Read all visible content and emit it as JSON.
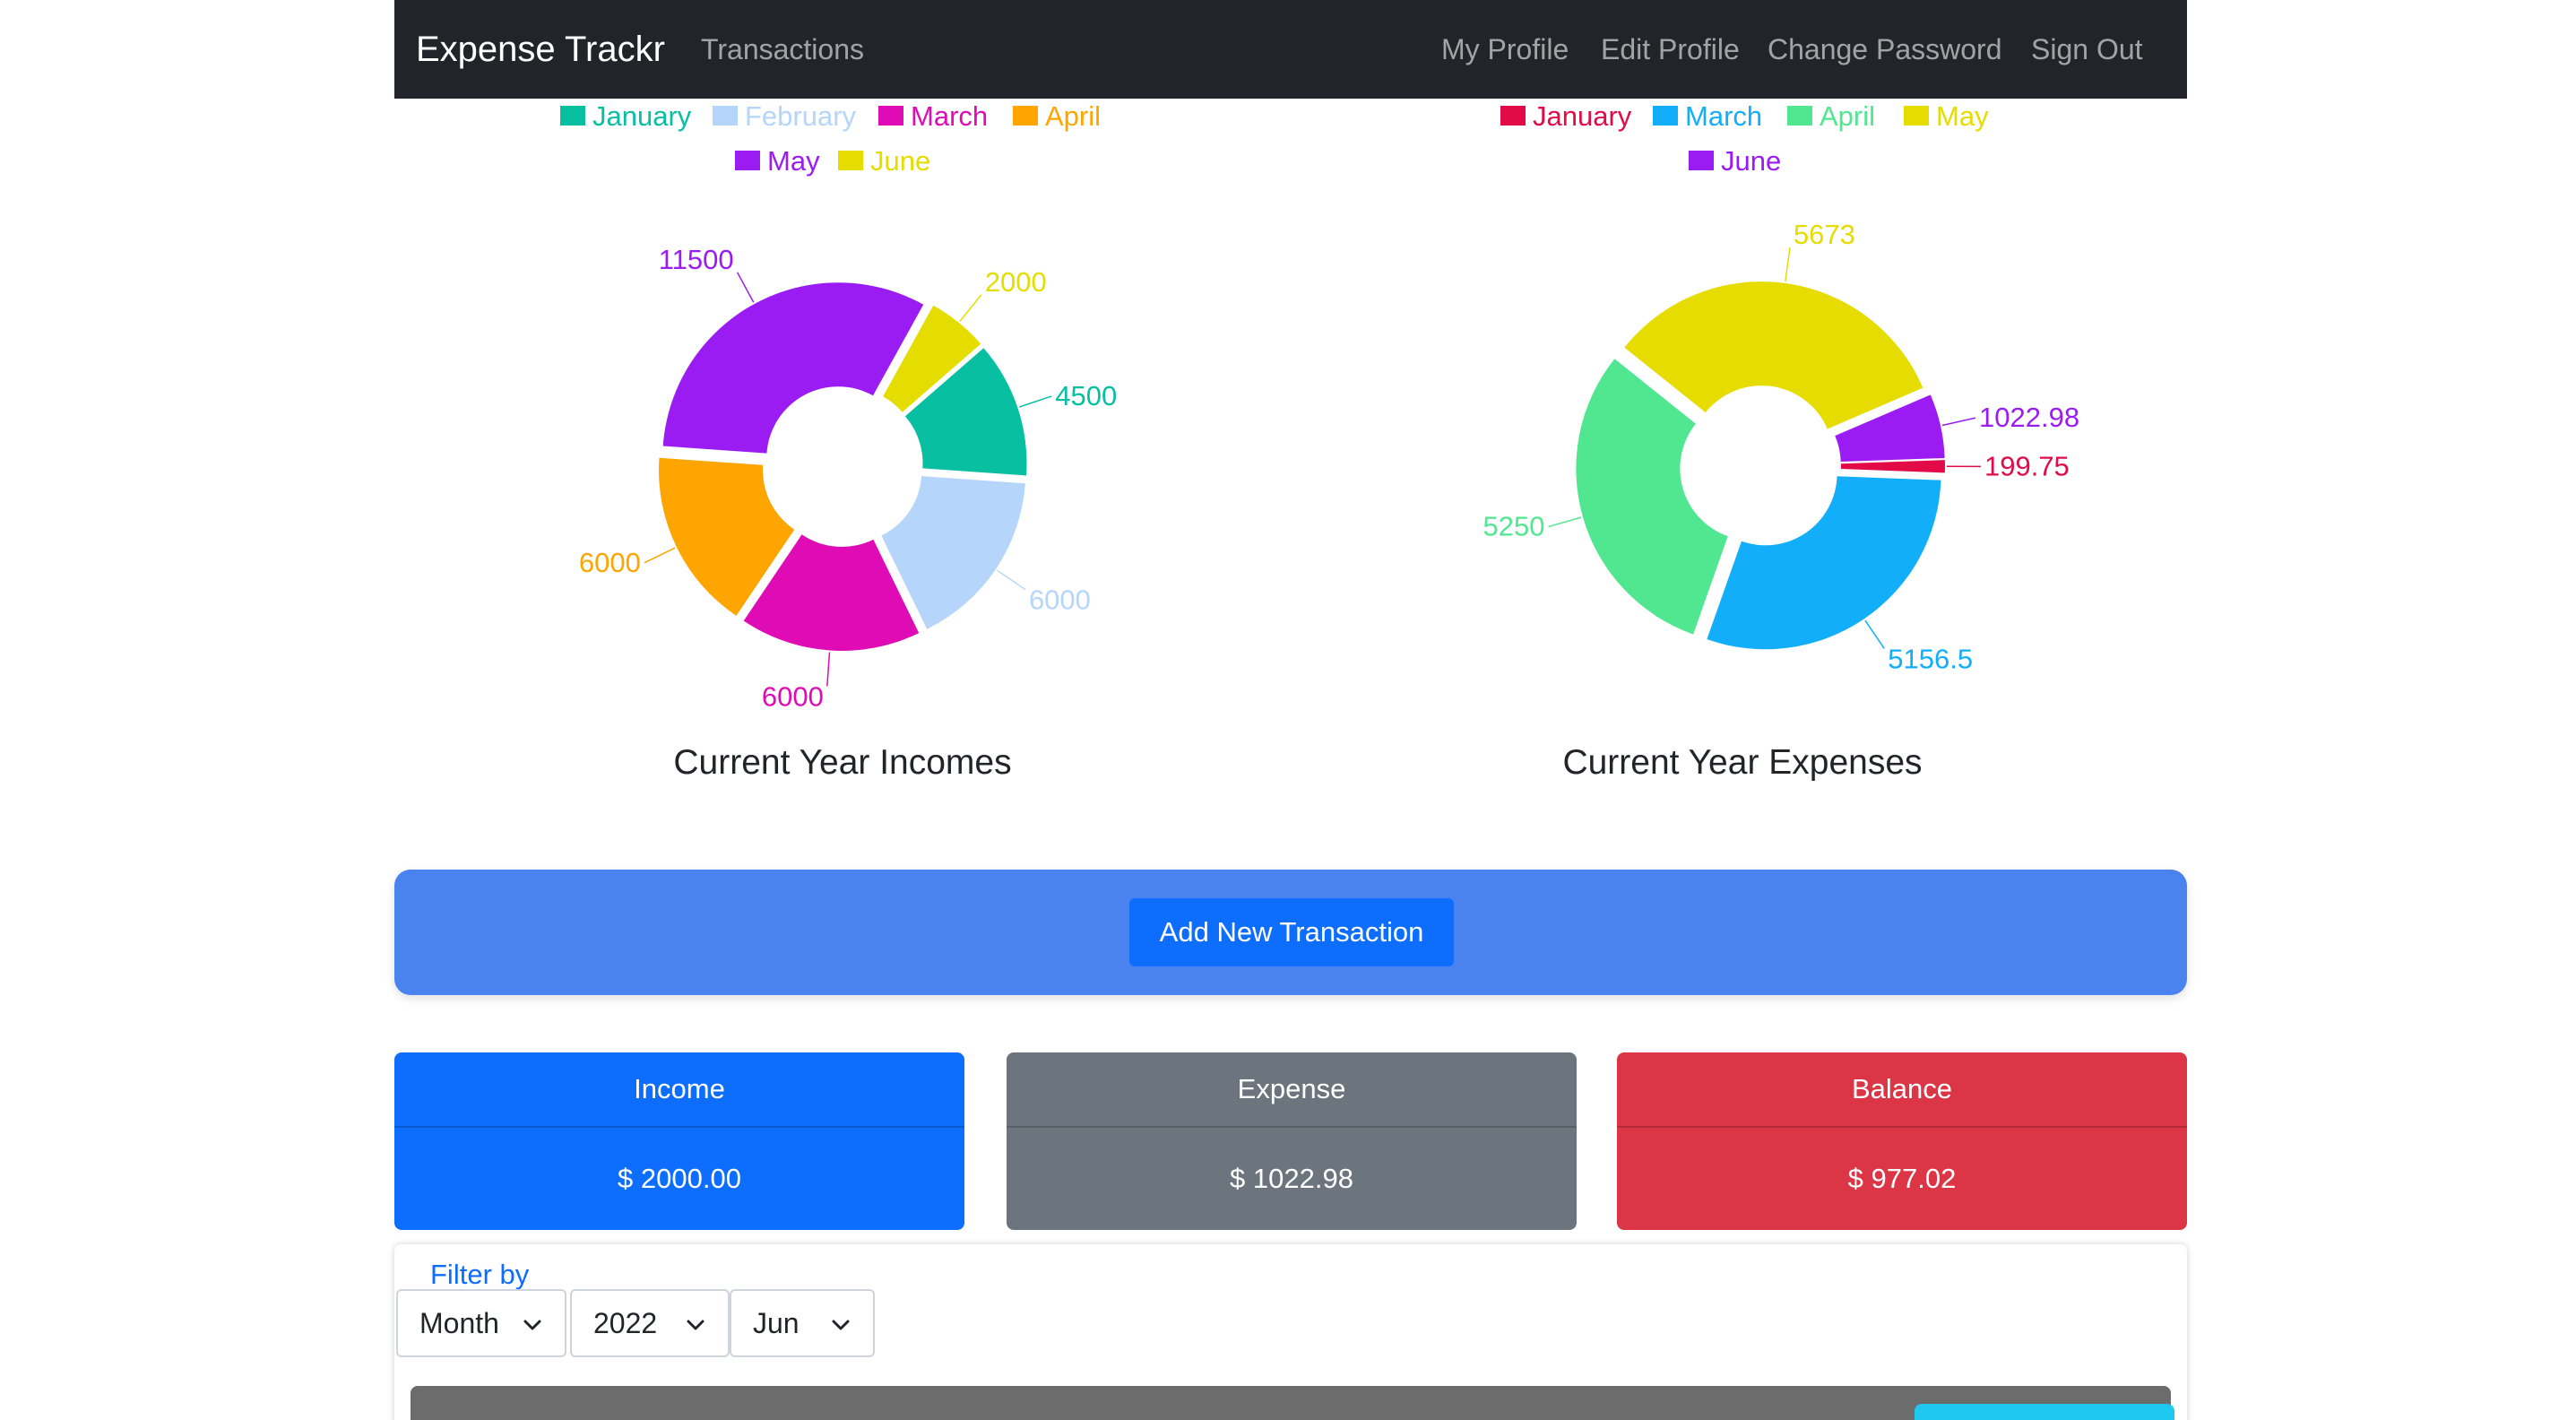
{
  "navbar": {
    "brand": "Expense Trackr",
    "transactions": "Transactions",
    "my_profile": "My Profile",
    "edit_profile": "Edit Profile",
    "change_password": "Change Password",
    "sign_out": "Sign Out"
  },
  "chart_data": [
    {
      "type": "pie",
      "title": "Current Year Incomes",
      "categories": [
        "January",
        "February",
        "March",
        "April",
        "May",
        "June"
      ],
      "values": [
        4500,
        6000,
        6000,
        6000,
        11500,
        2000
      ],
      "colors": [
        "#08bfa2",
        "#b5d5fb",
        "#df0bb5",
        "#fea500",
        "#9b1cf3",
        "#e5dd00"
      ]
    },
    {
      "type": "pie",
      "title": "Current Year Expenses",
      "categories": [
        "January",
        "March",
        "April",
        "May",
        "June"
      ],
      "values": [
        199.75,
        5156.5,
        5250,
        5673,
        1022.98
      ],
      "colors": [
        "#e20b47",
        "#12aef9",
        "#51e790",
        "#e6dc00",
        "#9b1cf3"
      ]
    }
  ],
  "actions": {
    "add_transaction": "Add New Transaction"
  },
  "summary": {
    "income": {
      "label": "Income",
      "value": "$ 2000.00",
      "color": "#0d6efd"
    },
    "expense": {
      "label": "Expense",
      "value": "$ 1022.98",
      "color": "#6c757d"
    },
    "balance": {
      "label": "Balance",
      "value": "$ 977.02",
      "color": "#dc3545"
    }
  },
  "filter": {
    "label": "Filter by",
    "period": "Month",
    "year": "2022",
    "month": "Jun"
  },
  "icons": {
    "dropdown": "chevron-down-icon"
  }
}
